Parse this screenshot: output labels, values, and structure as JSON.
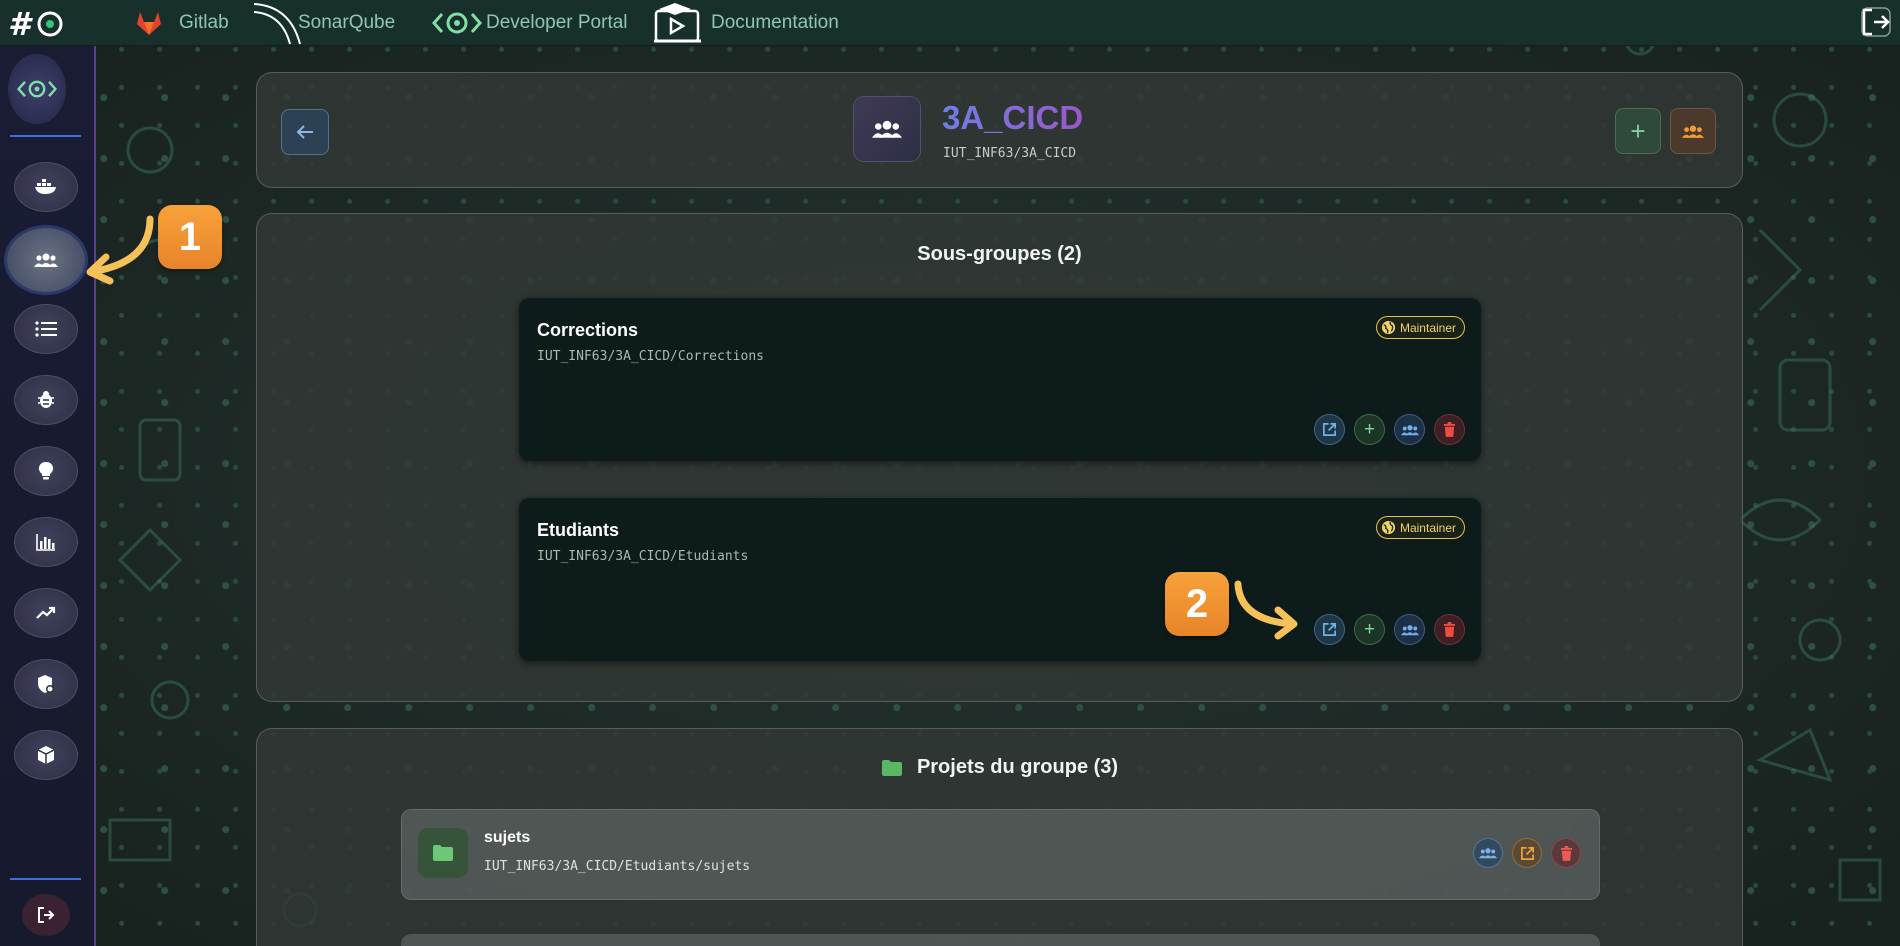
{
  "topbar": {
    "links": [
      {
        "label": "Gitlab",
        "icon": "gitlab-icon"
      },
      {
        "label": "SonarQube",
        "icon": "sonarqube-icon"
      },
      {
        "label": "Developer Portal",
        "icon": "developer-portal-icon"
      },
      {
        "label": "Documentation",
        "icon": "documentation-icon"
      }
    ]
  },
  "header": {
    "title": "3A_CICD",
    "path": "IUT_INF63/3A_CICD"
  },
  "subgroups": {
    "title": "Sous-groupes (2)",
    "items": [
      {
        "name": "Corrections",
        "path": "IUT_INF63/3A_CICD/Corrections",
        "role": "Maintainer"
      },
      {
        "name": "Etudiants",
        "path": "IUT_INF63/3A_CICD/Etudiants",
        "role": "Maintainer"
      }
    ]
  },
  "projects": {
    "title": "Projets du groupe (3)",
    "items": [
      {
        "name": "sujets",
        "path": "IUT_INF63/3A_CICD/Etudiants/sujets"
      }
    ]
  },
  "annotations": {
    "step1": "1",
    "step2": "2"
  },
  "colors": {
    "accent_orange": "#f39a36",
    "badge_gold": "#e9c24b",
    "title_gradient_start": "#6f7ee8",
    "title_gradient_end": "#9b58c9"
  }
}
